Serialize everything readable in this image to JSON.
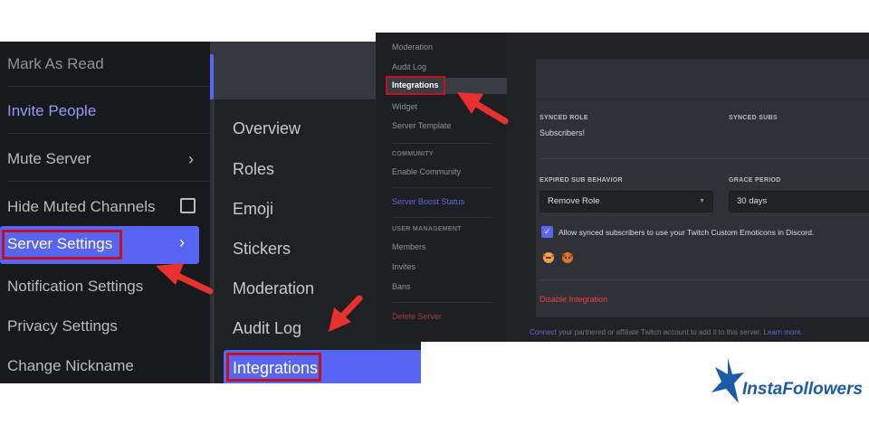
{
  "dropdown": {
    "items": [
      {
        "label": "Mark As Read"
      },
      {
        "label": "Invite People"
      },
      {
        "label": "Mute Server"
      },
      {
        "label": "Hide Muted Channels"
      },
      {
        "label": "Server Settings"
      },
      {
        "label": "Notification Settings"
      },
      {
        "label": "Privacy Settings"
      },
      {
        "label": "Change Nickname"
      }
    ]
  },
  "settings_nav": {
    "items": [
      {
        "label": "Overview"
      },
      {
        "label": "Roles"
      },
      {
        "label": "Emoji"
      },
      {
        "label": "Stickers"
      },
      {
        "label": "Moderation"
      },
      {
        "label": "Audit Log"
      },
      {
        "label": "Integrations"
      }
    ]
  },
  "integration_page": {
    "sidebar": {
      "items": [
        "Moderation",
        "Audit Log",
        "Integrations",
        "Widget",
        "Server Template"
      ],
      "community_header": "COMMUNITY",
      "enable_community": "Enable Community",
      "boost_status": "Server Boost Status",
      "user_mgmt_header": "USER MANAGEMENT",
      "members": "Members",
      "invites": "Invites",
      "bans": "Bans",
      "delete_server": "Delete Server"
    },
    "synced_role_label": "SYNCED ROLE",
    "synced_role_value": "Subscribers!",
    "synced_subs_label": "SYNCED SUBS",
    "expired_label": "EXPIRED SUB BEHAVIOR",
    "expired_value": "Remove Role",
    "grace_label": "GRACE PERIOD",
    "grace_value": "30 days",
    "emoticons_checkbox": "Allow synced subscribers to use your Twitch Custom Emoticons in Discord.",
    "emoticons_checked": true,
    "disable_link": "Disable Integration",
    "footer_prefix": "Connect",
    "footer_text": " your partnered or affiliate Twitch account to add it to this server.",
    "footer_learn": "Learn more."
  },
  "brand": {
    "name": "InstaFollowers"
  },
  "colors": {
    "accent": "#5865f2",
    "highlight_border": "#c1121f",
    "arrow": "#e8312f",
    "danger": "#ed4245",
    "brand_blue": "#1d5aa8"
  }
}
